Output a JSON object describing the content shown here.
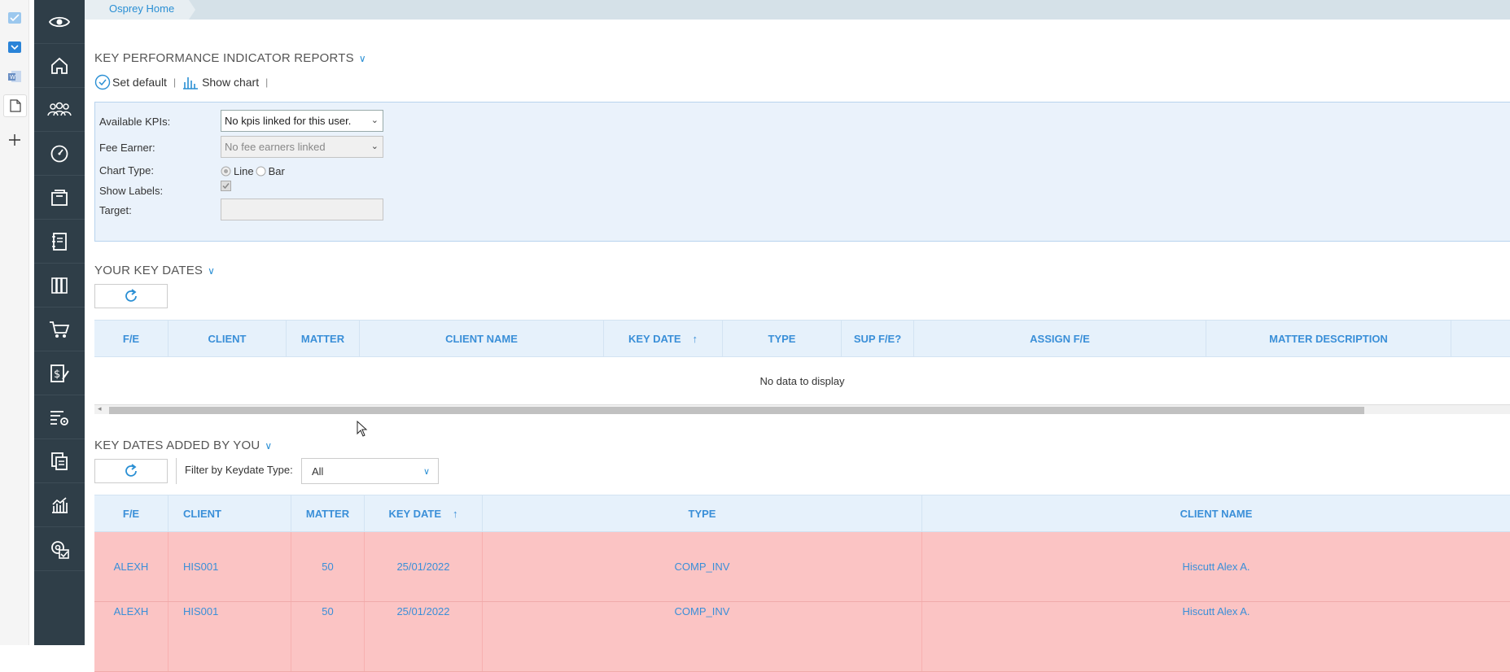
{
  "breadcrumb": {
    "home_label": "Osprey Home"
  },
  "left_strip": {
    "icons": [
      "mail-check-icon",
      "calendar-icon",
      "word-icon",
      "document-icon",
      "add-icon"
    ]
  },
  "sidebar": {
    "items": [
      {
        "icon": "eye-icon"
      },
      {
        "icon": "home-icon"
      },
      {
        "icon": "people-icon"
      },
      {
        "icon": "dashboard-icon"
      },
      {
        "icon": "archive-icon"
      },
      {
        "icon": "contacts-book-icon"
      },
      {
        "icon": "library-icon"
      },
      {
        "icon": "cart-icon"
      },
      {
        "icon": "billing-icon"
      },
      {
        "icon": "list-settings-icon"
      },
      {
        "icon": "documents-icon"
      },
      {
        "icon": "analytics-icon"
      },
      {
        "icon": "settings-check-icon"
      }
    ]
  },
  "kpi": {
    "title": "KEY PERFORMANCE INDICATOR REPORTS",
    "set_default": "Set default",
    "sep1": "|",
    "show_chart": "Show chart",
    "sep2": "|",
    "available_label": "Available KPIs:",
    "available_value": "No kpis linked for this user.",
    "fee_earner_label": "Fee Earner:",
    "fee_earner_value": "No fee earners linked",
    "chart_type_label": "Chart Type:",
    "chart_type_line": "Line",
    "chart_type_bar": "Bar",
    "chart_type_selected": "Line",
    "show_labels_label": "Show Labels:",
    "show_labels_checked": true,
    "target_label": "Target:",
    "target_value": ""
  },
  "your_key_dates": {
    "title": "YOUR KEY DATES",
    "columns": [
      "F/E",
      "CLIENT",
      "MATTER",
      "CLIENT NAME",
      "KEY DATE",
      "TYPE",
      "SUP F/E?",
      "ASSIGN F/E",
      "MATTER DESCRIPTION"
    ],
    "sort_indicator": "↑",
    "empty_text": "No data to display"
  },
  "added_by_you": {
    "title": "KEY DATES ADDED BY YOU",
    "filter_label": "Filter by Keydate Type:",
    "filter_value": "All",
    "columns": [
      "F/E",
      "CLIENT",
      "MATTER",
      "KEY DATE",
      "TYPE",
      "CLIENT NAME"
    ],
    "sort_indicator": "↑",
    "rows": [
      {
        "fe": "ALEXH",
        "client": "HIS001",
        "matter": "50",
        "key_date": "25/01/2022",
        "type": "COMP_INV",
        "client_name": "Hiscutt Alex A."
      },
      {
        "fe": "ALEXH",
        "client": "HIS001",
        "matter": "50",
        "key_date": "25/01/2022",
        "type": "COMP_INV",
        "client_name": "Hiscutt Alex A."
      }
    ]
  },
  "colors": {
    "accent": "#2a8fd4",
    "sidebar_bg": "#2f3e48",
    "row_highlight": "#fbc4c4",
    "panel_bg": "#eaf2fb"
  }
}
